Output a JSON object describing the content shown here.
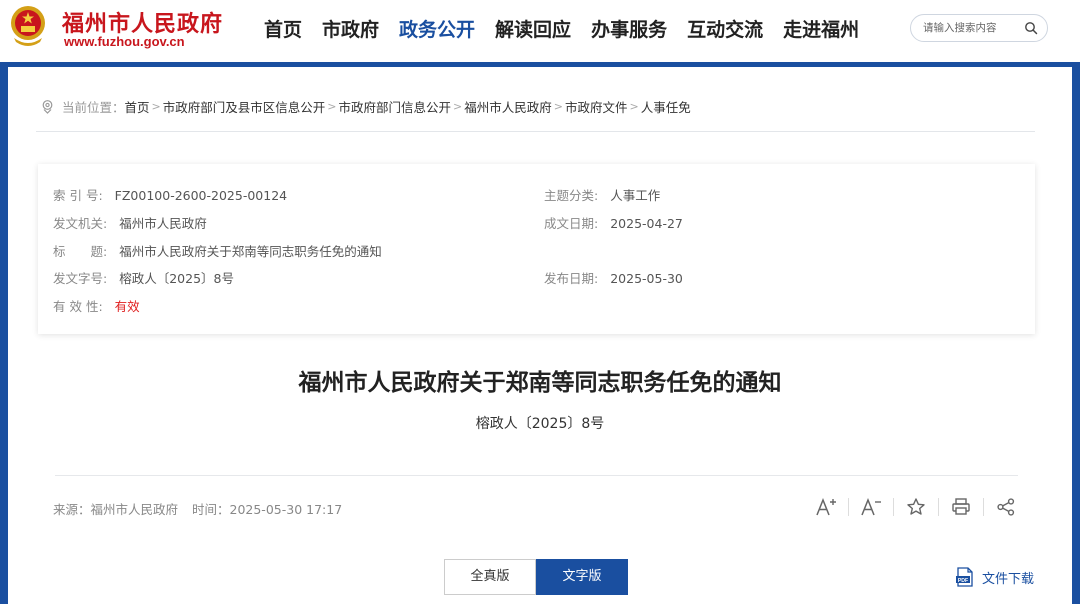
{
  "header": {
    "site_name": "福州市人民政府",
    "site_url": "www.fuzhou.gov.cn",
    "nav": [
      {
        "label": "首页",
        "active": false
      },
      {
        "label": "市政府",
        "active": false
      },
      {
        "label": "政务公开",
        "active": true
      },
      {
        "label": "解读回应",
        "active": false
      },
      {
        "label": "办事服务",
        "active": false
      },
      {
        "label": "互动交流",
        "active": false
      },
      {
        "label": "走进福州",
        "active": false
      }
    ],
    "search_placeholder": "请输入搜索内容"
  },
  "breadcrumb": {
    "lead": "当前位置：",
    "items": [
      "首页",
      "市政府部门及县市区信息公开",
      "市政府部门信息公开",
      "福州市人民政府",
      "市政府文件",
      "人事任免"
    ]
  },
  "info": {
    "index_label": "索 引 号:",
    "index_value": "FZ00100-2600-2025-00124",
    "topic_label": "主题分类:",
    "topic_value": "人事工作",
    "issuer_label": "发文机关:",
    "issuer_value": "福州市人民政府",
    "created_label": "成文日期:",
    "created_value": "2025-04-27",
    "title_label": "标　　题:",
    "title_value": "福州市人民政府关于郑南等同志职务任免的通知",
    "docno_label": "发文字号:",
    "docno_value": "榕政人〔2025〕8号",
    "published_label": "发布日期:",
    "published_value": "2025-05-30",
    "validity_label": "有 效 性:",
    "validity_value": "有效"
  },
  "document": {
    "title": "福州市人民政府关于郑南等同志职务任免的通知",
    "number": "榕政人〔2025〕8号"
  },
  "meta": {
    "source": "来源：福州市人民政府",
    "time": "时间：2025-05-30 17:17"
  },
  "tools": [
    "font-increase-icon",
    "font-decrease-icon",
    "star-icon",
    "print-icon",
    "share-icon"
  ],
  "toggle": {
    "full_label": "全真版",
    "text_label": "文字版",
    "active": "text"
  },
  "download_label": "文件下载",
  "colors": {
    "brand_red": "#c8161d",
    "brand_blue": "#1a4fa0",
    "valid_red": "#e02020"
  }
}
